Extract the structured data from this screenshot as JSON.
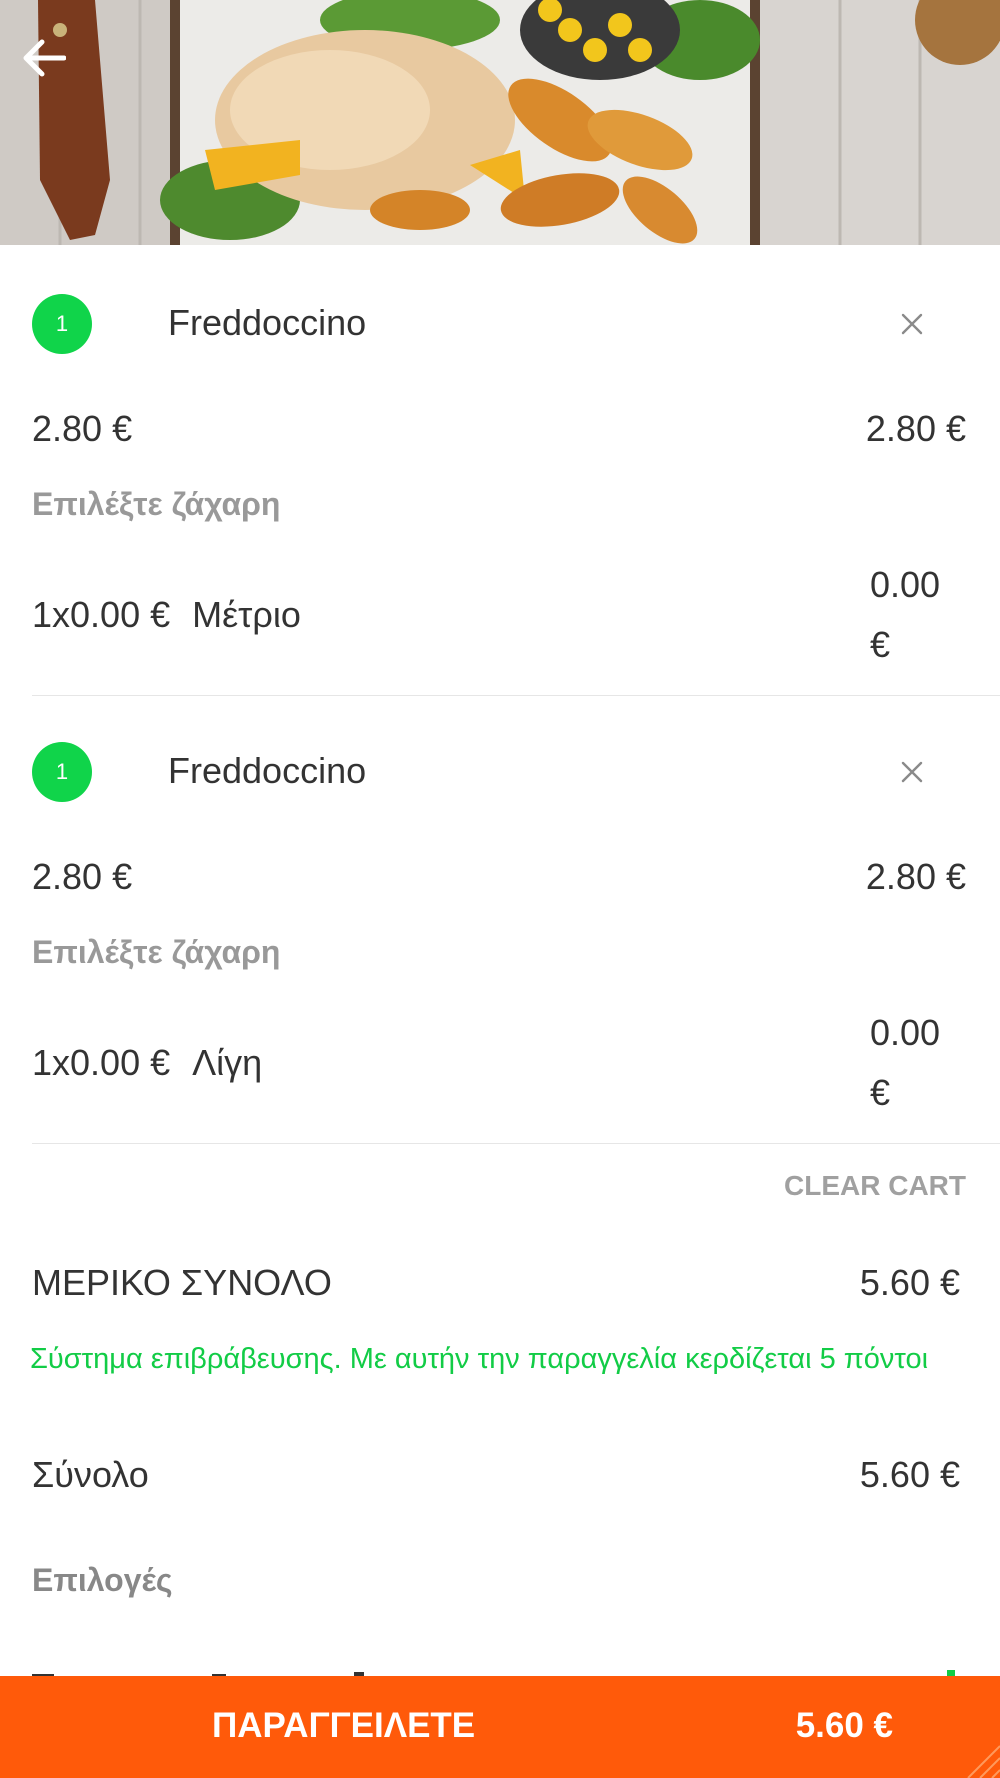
{
  "header": {
    "back_icon": "arrow-left-icon",
    "image": "food-tray-photo"
  },
  "cart": {
    "items": [
      {
        "quantity": "1",
        "name": "Freddoccino",
        "unit_price": "2.80 €",
        "line_price": "2.80 €",
        "option_group": "Επιλέξτε ζάχαρη",
        "option_qty_price": "1x0.00 €",
        "option_name": "Μέτριο",
        "option_price_amount": "0.00",
        "option_price_currency": "€"
      },
      {
        "quantity": "1",
        "name": "Freddoccino",
        "unit_price": "2.80 €",
        "line_price": "2.80 €",
        "option_group": "Επιλέξτε ζάχαρη",
        "option_qty_price": "1x0.00 €",
        "option_name": "Λίγη",
        "option_price_amount": "0.00",
        "option_price_currency": "€"
      }
    ],
    "clear_cart_label": "CLEAR CART"
  },
  "summary": {
    "subtotal_label": "ΜΕΡΙΚΟ ΣΥΝΟΛΟ",
    "subtotal_value": "5.60 €",
    "reward_text": "Σύστημα επιβράβευσης. Με αυτήν την παραγγελία κερδίζεται 5 πόντοι",
    "total_label": "Σύνολο",
    "total_value": "5.60 €",
    "options_label": "Επιλογές"
  },
  "order_button": {
    "label": "ΠΑΡΑΓΓΕΙΛΕΤΕ",
    "total": "5.60 €"
  },
  "colors": {
    "badge_green": "#10d44a",
    "reward_green": "#12cc46",
    "order_orange": "#ff5a0a"
  }
}
